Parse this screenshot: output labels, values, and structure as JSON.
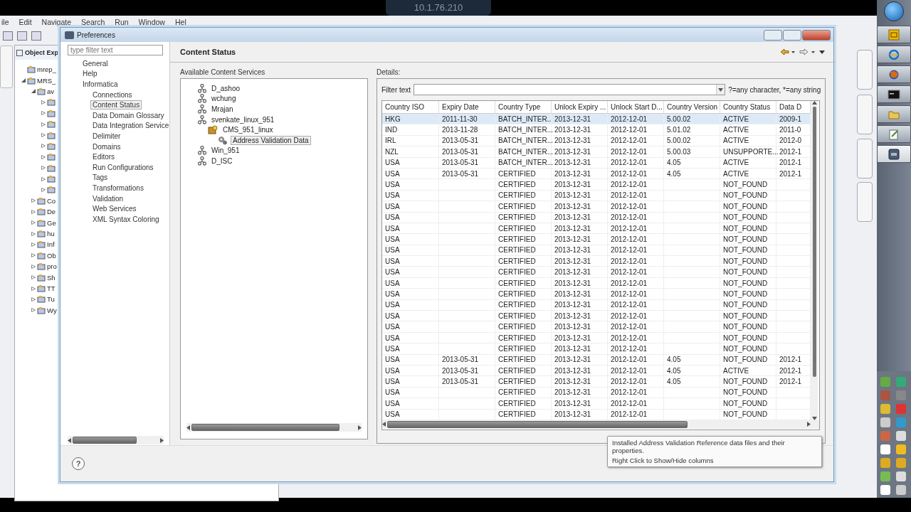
{
  "remote_bar": {
    "title": "10.1.76.210"
  },
  "ide": {
    "menu": [
      "ile",
      "Edit",
      "Navigate",
      "Search",
      "Run",
      "Window",
      "Hel"
    ],
    "object_explorer": {
      "title": "Object Exp",
      "tree": [
        {
          "label": "mrep_"
        },
        {
          "label": "MRS_",
          "expanded": true,
          "children": [
            {
              "label": "av",
              "expanded": true,
              "children": [
                {
                  "expanded": false
                },
                {
                  "expanded": false
                },
                {
                  "expanded": false
                },
                {
                  "expanded": false
                },
                {
                  "expanded": false
                },
                {
                  "expanded": false
                },
                {
                  "expanded": false
                },
                {
                  "expanded": false
                },
                {
                  "expanded": false
                }
              ]
            },
            {
              "label": "Co",
              "expanded": false
            },
            {
              "label": "De",
              "expanded": false
            },
            {
              "label": "Ge",
              "expanded": false
            },
            {
              "label": "hu",
              "expanded": false
            },
            {
              "label": "Inf",
              "expanded": false
            },
            {
              "label": "Ob",
              "expanded": false
            },
            {
              "label": "pro",
              "expanded": false
            },
            {
              "label": "Sh",
              "expanded": false
            },
            {
              "label": "TT",
              "expanded": false
            },
            {
              "label": "Tu",
              "expanded": false
            },
            {
              "label": "Wy",
              "expanded": false
            }
          ]
        }
      ]
    }
  },
  "dialog": {
    "title": "Preferences",
    "nav": {
      "filter": {
        "placeholder": "type filter text"
      },
      "tree": [
        {
          "label": "General",
          "selected": false
        },
        {
          "label": "Help",
          "selected": false
        },
        {
          "label": "Informatica",
          "selected": false,
          "children": [
            {
              "label": "Connections",
              "selected": false
            },
            {
              "label": "Content Status",
              "selected": true
            },
            {
              "label": "Data Domain Glossary",
              "selected": false
            },
            {
              "label": "Data Integration Service",
              "selected": false
            },
            {
              "label": "Delimiter",
              "selected": false
            },
            {
              "label": "Domains",
              "selected": false
            },
            {
              "label": "Editors",
              "selected": false
            },
            {
              "label": "Run Configurations",
              "selected": false
            },
            {
              "label": "Tags",
              "selected": false
            },
            {
              "label": "Transformations",
              "selected": false
            },
            {
              "label": "Validation",
              "selected": false
            },
            {
              "label": "Web Services",
              "selected": false
            },
            {
              "label": "XML Syntax Coloring",
              "selected": false
            }
          ]
        }
      ]
    },
    "page_title": "Content Status",
    "services": {
      "label": "Available Content Services",
      "tree": [
        {
          "label": "D_ashoo",
          "kind": "service",
          "selected": false
        },
        {
          "label": "wchung",
          "kind": "service",
          "selected": false
        },
        {
          "label": "Mrajan",
          "kind": "service",
          "selected": false
        },
        {
          "label": "svenkate_linux_951",
          "kind": "service",
          "selected": false,
          "children": [
            {
              "label": "CMS_951_linux",
              "kind": "cms",
              "selected": false,
              "children": [
                {
                  "label": "Address Validation Data",
                  "kind": "data",
                  "selected": true
                }
              ]
            }
          ]
        },
        {
          "label": "Win_951",
          "kind": "service",
          "selected": false
        },
        {
          "label": "D_ISC",
          "kind": "service",
          "selected": false
        }
      ]
    },
    "details": {
      "label": "Details:",
      "filter_label": "Filter text",
      "filter_hint": "?=any character, *=any string",
      "table": {
        "columns": [
          "Country ISO",
          "Expiry Date",
          "Country Type",
          "Unlock Expiry ...",
          "Unlock Start D...",
          "Country Version",
          "Country Status",
          "Data D"
        ],
        "rows": [
          {
            "selected": true,
            "cells": [
              "HKG",
              "2011-11-30",
              "BATCH_INTER...",
              "2013-12-31",
              "2012-12-01",
              "5.00.02",
              "ACTIVE",
              "2009-1"
            ]
          },
          {
            "selected": false,
            "cells": [
              "IND",
              "2013-11-28",
              "BATCH_INTER...",
              "2013-12-31",
              "2012-12-01",
              "5.01.02",
              "ACTIVE",
              "2011-0"
            ]
          },
          {
            "selected": false,
            "cells": [
              "IRL",
              "2013-05-31",
              "BATCH_INTER...",
              "2013-12-31",
              "2012-12-01",
              "5.00.02",
              "ACTIVE",
              "2012-0"
            ]
          },
          {
            "selected": false,
            "cells": [
              "NZL",
              "2013-05-31",
              "BATCH_INTER...",
              "2013-12-31",
              "2012-12-01",
              "5.00.03",
              "UNSUPPORTE...",
              "2012-1"
            ]
          },
          {
            "selected": false,
            "cells": [
              "USA",
              "2013-05-31",
              "BATCH_INTER...",
              "2013-12-31",
              "2012-12-01",
              "4.05",
              "ACTIVE",
              "2012-1"
            ]
          },
          {
            "selected": false,
            "cells": [
              "USA",
              "2013-05-31",
              "CERTIFIED",
              "2013-12-31",
              "2012-12-01",
              "4.05",
              "ACTIVE",
              "2012-1"
            ]
          },
          {
            "selected": false,
            "cells": [
              "USA",
              null,
              "CERTIFIED",
              "2013-12-31",
              "2012-12-01",
              null,
              "NOT_FOUND",
              null
            ]
          },
          {
            "selected": false,
            "cells": [
              "USA",
              null,
              "CERTIFIED",
              "2013-12-31",
              "2012-12-01",
              null,
              "NOT_FOUND",
              null
            ]
          },
          {
            "selected": false,
            "cells": [
              "USA",
              null,
              "CERTIFIED",
              "2013-12-31",
              "2012-12-01",
              null,
              "NOT_FOUND",
              null
            ]
          },
          {
            "selected": false,
            "cells": [
              "USA",
              null,
              "CERTIFIED",
              "2013-12-31",
              "2012-12-01",
              null,
              "NOT_FOUND",
              null
            ]
          },
          {
            "selected": false,
            "cells": [
              "USA",
              null,
              "CERTIFIED",
              "2013-12-31",
              "2012-12-01",
              null,
              "NOT_FOUND",
              null
            ]
          },
          {
            "selected": false,
            "cells": [
              "USA",
              null,
              "CERTIFIED",
              "2013-12-31",
              "2012-12-01",
              null,
              "NOT_FOUND",
              null
            ]
          },
          {
            "selected": false,
            "cells": [
              "USA",
              null,
              "CERTIFIED",
              "2013-12-31",
              "2012-12-01",
              null,
              "NOT_FOUND",
              null
            ]
          },
          {
            "selected": false,
            "cells": [
              "USA",
              null,
              "CERTIFIED",
              "2013-12-31",
              "2012-12-01",
              null,
              "NOT_FOUND",
              null
            ]
          },
          {
            "selected": false,
            "cells": [
              "USA",
              null,
              "CERTIFIED",
              "2013-12-31",
              "2012-12-01",
              null,
              "NOT_FOUND",
              null
            ]
          },
          {
            "selected": false,
            "cells": [
              "USA",
              null,
              "CERTIFIED",
              "2013-12-31",
              "2012-12-01",
              null,
              "NOT_FOUND",
              null
            ]
          },
          {
            "selected": false,
            "cells": [
              "USA",
              null,
              "CERTIFIED",
              "2013-12-31",
              "2012-12-01",
              null,
              "NOT_FOUND",
              null
            ]
          },
          {
            "selected": false,
            "cells": [
              "USA",
              null,
              "CERTIFIED",
              "2013-12-31",
              "2012-12-01",
              null,
              "NOT_FOUND",
              null
            ]
          },
          {
            "selected": false,
            "cells": [
              "USA",
              null,
              "CERTIFIED",
              "2013-12-31",
              "2012-12-01",
              null,
              "NOT_FOUND",
              null
            ]
          },
          {
            "selected": false,
            "cells": [
              "USA",
              null,
              "CERTIFIED",
              "2013-12-31",
              "2012-12-01",
              null,
              "NOT_FOUND",
              null
            ]
          },
          {
            "selected": false,
            "cells": [
              "USA",
              null,
              "CERTIFIED",
              "2013-12-31",
              "2012-12-01",
              null,
              "NOT_FOUND",
              null
            ]
          },
          {
            "selected": false,
            "cells": [
              "USA",
              null,
              "CERTIFIED",
              "2013-12-31",
              "2012-12-01",
              null,
              "NOT_FOUND",
              null
            ]
          },
          {
            "selected": false,
            "cells": [
              "USA",
              "2013-05-31",
              "CERTIFIED",
              "2013-12-31",
              "2012-12-01",
              "4.05",
              "NOT_FOUND",
              "2012-1"
            ]
          },
          {
            "selected": false,
            "cells": [
              "USA",
              "2013-05-31",
              "CERTIFIED",
              "2013-12-31",
              "2012-12-01",
              "4.05",
              "ACTIVE",
              "2012-1"
            ]
          },
          {
            "selected": false,
            "cells": [
              "USA",
              "2013-05-31",
              "CERTIFIED",
              "2013-12-31",
              "2012-12-01",
              "4.05",
              "NOT_FOUND",
              "2012-1"
            ]
          },
          {
            "selected": false,
            "cells": [
              "USA",
              null,
              "CERTIFIED",
              "2013-12-31",
              "2012-12-01",
              null,
              "NOT_FOUND",
              null
            ]
          },
          {
            "selected": false,
            "cells": [
              "USA",
              null,
              "CERTIFIED",
              "2013-12-31",
              "2012-12-01",
              null,
              "NOT_FOUND",
              null
            ]
          },
          {
            "selected": false,
            "cells": [
              "USA",
              null,
              "CERTIFIED",
              "2013-12-31",
              "2012-12-01",
              null,
              "NOT_FOUND",
              null
            ]
          }
        ]
      }
    },
    "help_button": "?",
    "tooltip": {
      "lines": [
        "Installed Address Validation Reference data files and their properties.",
        "Right Click to Show/Hide columns"
      ]
    }
  },
  "taskbar": {
    "apps": [
      {
        "kind": "mail",
        "selected": false
      },
      {
        "kind": "browser",
        "selected": false
      },
      {
        "kind": "fox",
        "selected": false
      },
      {
        "kind": "console",
        "selected": false
      },
      {
        "kind": "folder",
        "selected": false
      },
      {
        "kind": "notepad",
        "selected": false
      },
      {
        "kind": "dv",
        "selected": true
      }
    ]
  }
}
